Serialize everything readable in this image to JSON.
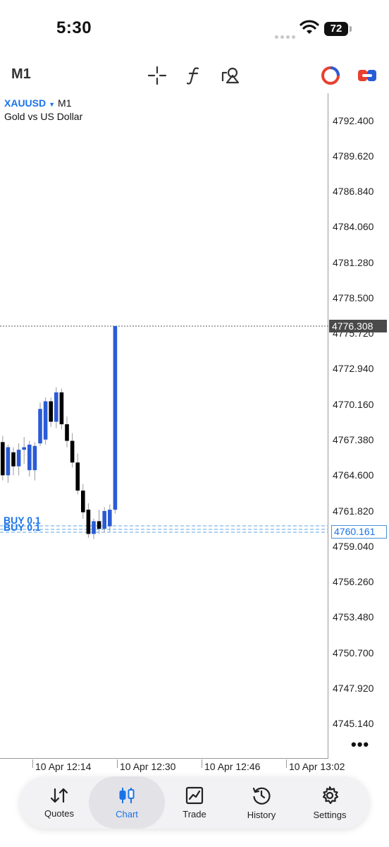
{
  "status_bar": {
    "time": "5:30",
    "battery": "72"
  },
  "toolbar": {
    "timeframe": "M1",
    "icons": [
      "crosshair-icon",
      "function-icon",
      "objects-icon",
      "one-click-trading-icon",
      "trade-toggle-icon"
    ]
  },
  "chart": {
    "symbol": "XAUUSD",
    "period": "M1",
    "description": "Gold vs US Dollar",
    "current_price": "4776.308",
    "buy_price": "4760.161",
    "buy_labels": [
      "BUY 0.1",
      "BUY 0.1"
    ],
    "colors": {
      "bull": "#2a5bd7",
      "bear": "#000000",
      "order_line": "#4a90d9"
    }
  },
  "chart_data": {
    "type": "candlestick",
    "y_axis_ticks": [
      "4792.400",
      "4789.620",
      "4786.840",
      "4784.060",
      "4781.280",
      "4778.500",
      "4775.720",
      "4772.940",
      "4770.160",
      "4767.380",
      "4764.600",
      "4761.820",
      "4759.040",
      "4756.260",
      "4753.480",
      "4750.700",
      "4747.920",
      "4745.140"
    ],
    "x_axis_ticks": [
      "10 Apr 12:14",
      "10 Apr 12:30",
      "10 Apr 12:46",
      "10 Apr 13:02"
    ],
    "ylim": [
      4743.5,
      4794.8
    ],
    "candles": [
      {
        "o": 4767.2,
        "h": 4767.7,
        "l": 4764.2,
        "c": 4764.6
      },
      {
        "o": 4764.6,
        "h": 4767.0,
        "l": 4764.0,
        "c": 4766.8
      },
      {
        "o": 4766.4,
        "h": 4766.8,
        "l": 4764.6,
        "c": 4765.3
      },
      {
        "o": 4765.3,
        "h": 4767.1,
        "l": 4764.6,
        "c": 4766.6
      },
      {
        "o": 4766.6,
        "h": 4767.6,
        "l": 4765.5,
        "c": 4766.8
      },
      {
        "o": 4765.0,
        "h": 4767.3,
        "l": 4764.5,
        "c": 4767.0
      },
      {
        "o": 4765.0,
        "h": 4767.2,
        "l": 4764.2,
        "c": 4766.9
      },
      {
        "o": 4767.1,
        "h": 4770.3,
        "l": 4766.9,
        "c": 4769.8
      },
      {
        "o": 4767.4,
        "h": 4770.7,
        "l": 4767.0,
        "c": 4770.4
      },
      {
        "o": 4770.4,
        "h": 4770.7,
        "l": 4768.4,
        "c": 4768.8
      },
      {
        "o": 4768.8,
        "h": 4771.5,
        "l": 4768.3,
        "c": 4771.1
      },
      {
        "o": 4771.1,
        "h": 4771.4,
        "l": 4768.2,
        "c": 4768.6
      },
      {
        "o": 4768.6,
        "h": 4769.2,
        "l": 4766.8,
        "c": 4767.3
      },
      {
        "o": 4767.3,
        "h": 4767.9,
        "l": 4765.2,
        "c": 4765.6
      },
      {
        "o": 4765.6,
        "h": 4766.3,
        "l": 4763.1,
        "c": 4763.4
      },
      {
        "o": 4763.4,
        "h": 4763.9,
        "l": 4761.2,
        "c": 4761.7
      },
      {
        "o": 4761.9,
        "h": 4762.4,
        "l": 4759.7,
        "c": 4760.0
      },
      {
        "o": 4760.0,
        "h": 4761.2,
        "l": 4759.6,
        "c": 4761.0
      },
      {
        "o": 4761.0,
        "h": 4761.9,
        "l": 4760.0,
        "c": 4760.4
      },
      {
        "o": 4760.4,
        "h": 4762.1,
        "l": 4760.1,
        "c": 4761.8
      },
      {
        "o": 4760.6,
        "h": 4762.3,
        "l": 4760.2,
        "c": 4761.9
      },
      {
        "o": 4761.9,
        "h": 4776.3,
        "l": 4761.6,
        "c": 4776.3
      }
    ]
  },
  "nav": {
    "items": [
      {
        "label": "Quotes",
        "icon": "quotes-icon"
      },
      {
        "label": "Chart",
        "icon": "chart-icon"
      },
      {
        "label": "Trade",
        "icon": "trade-icon"
      },
      {
        "label": "History",
        "icon": "history-icon"
      },
      {
        "label": "Settings",
        "icon": "settings-icon"
      }
    ]
  }
}
